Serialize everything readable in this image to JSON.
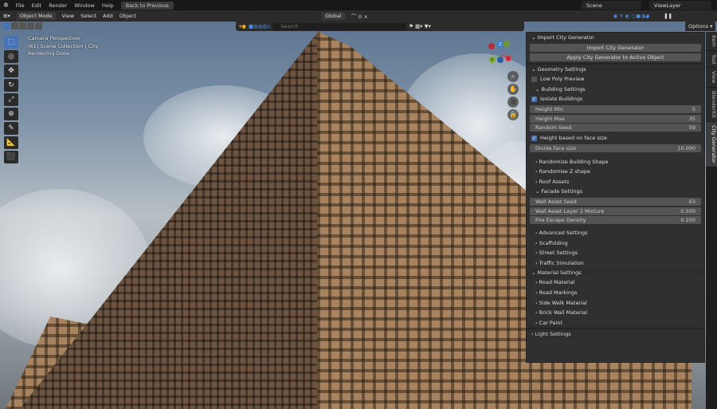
{
  "topbar": {
    "menus": [
      "File",
      "Edit",
      "Render",
      "Window",
      "Help"
    ],
    "back_button": "Back to Previous",
    "scene": "Scene",
    "view_layer": "ViewLayer"
  },
  "header": {
    "mode": "Object Mode",
    "menus": [
      "View",
      "Select",
      "Add",
      "Object"
    ],
    "transform_orientation": "Global",
    "options": "Options"
  },
  "viewport": {
    "search_placeholder": "Search",
    "info": [
      "Camera Perspective",
      "(61) Scene Collection | City",
      "Rendering Done"
    ],
    "gizmo": {
      "z": "Z",
      "y": "Y",
      "x": "X"
    }
  },
  "panel": {
    "import": {
      "title": "Import City Generator",
      "buttons": [
        "Import City Generator",
        "Apply City Generator to Active Object"
      ]
    },
    "geometry": {
      "title": "Geometry Settings",
      "low_poly": "Low Poly Preview",
      "building_settings": "Building Settings",
      "isolate": "Isolate Buildings",
      "fields": [
        {
          "label": "Height Min",
          "value": "5"
        },
        {
          "label": "Height Max",
          "value": "35"
        },
        {
          "label": "Random Seed",
          "value": "59"
        }
      ],
      "height_face": "Height based on face size",
      "divide": {
        "label": "Divide face size",
        "value": "10.000"
      },
      "subpanels": [
        "Randomize Building Shape",
        "Randomise Z shape",
        "Roof Assets"
      ],
      "facade": "Facade Settings",
      "facade_fields": [
        {
          "label": "Wall Asset Seed",
          "value": "63"
        },
        {
          "label": "Wall Asset Layer 2 Mixture",
          "value": "0.500"
        },
        {
          "label": "Fire Escape Density",
          "value": "0.250"
        }
      ],
      "more": [
        "Advanced Settings",
        "Scaffolding",
        "Street Settings",
        "Traffic Simulation"
      ]
    },
    "material": {
      "title": "Material Settings",
      "items": [
        "Road Material",
        "Road Markings",
        "Side Walk Material",
        "Brick Wall  Material",
        "Car Paint"
      ]
    },
    "light": {
      "title": "Light Settings"
    }
  },
  "tabs": [
    "Item",
    "Tool",
    "View",
    "BlenderKit",
    "City Generator"
  ]
}
